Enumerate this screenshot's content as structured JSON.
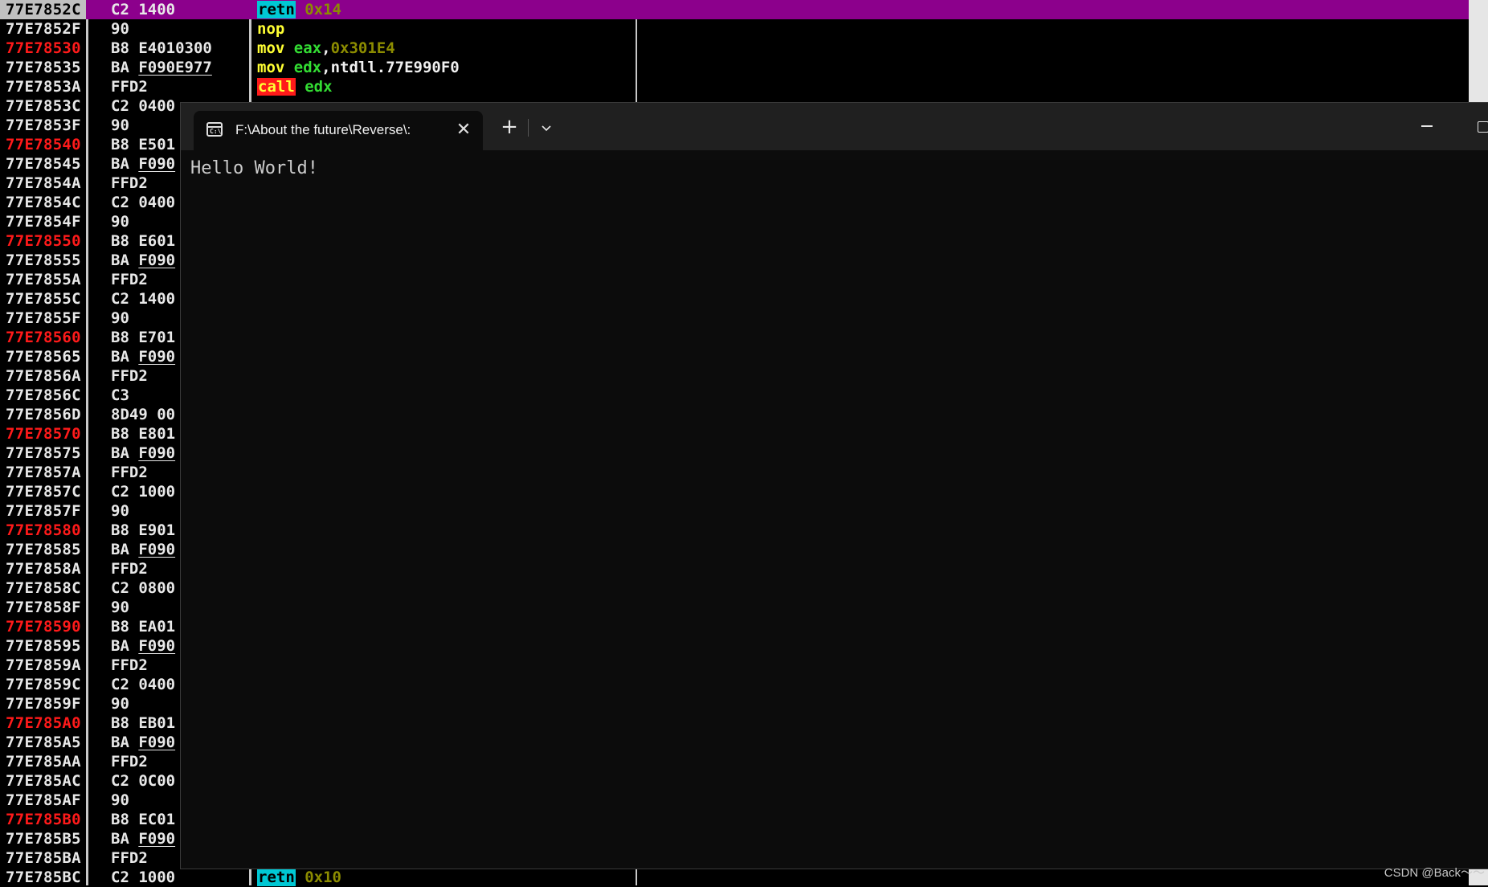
{
  "disassembly": {
    "top_rows": [
      {
        "addr": "77E7852C",
        "hex": "C2 1400",
        "mnemonic": "retn",
        "operand": "0x14",
        "selected": true
      },
      {
        "addr": "77E7852F",
        "hex": "90",
        "mnemonic": "nop",
        "operand": ""
      },
      {
        "addr": "77E78530",
        "hex": "B8 E4010300",
        "mnemonic": "mov",
        "operand_reg": "eax",
        "operand": "0x301E4",
        "red": true
      },
      {
        "addr": "77E78535",
        "hex_prefix": "BA ",
        "hex_u": "F090E977",
        "mnemonic": "mov",
        "operand_reg": "edx",
        "operand": "ntdll.77E990F0"
      },
      {
        "addr": "77E7853A",
        "hex": "FFD2",
        "mnemonic": "call",
        "operand_reg": "edx",
        "operand": ""
      }
    ],
    "rows": [
      {
        "addr": "77E7853C",
        "hex": "C2 0400"
      },
      {
        "addr": "77E7853F",
        "hex": "90"
      },
      {
        "addr": "77E78540",
        "hex": "B8 E501",
        "red": true
      },
      {
        "addr": "77E78545",
        "hex_prefix": "BA ",
        "hex_u": "F090"
      },
      {
        "addr": "77E7854A",
        "hex": "FFD2"
      },
      {
        "addr": "77E7854C",
        "hex": "C2 0400"
      },
      {
        "addr": "77E7854F",
        "hex": "90"
      },
      {
        "addr": "77E78550",
        "hex": "B8 E601",
        "red": true
      },
      {
        "addr": "77E78555",
        "hex_prefix": "BA ",
        "hex_u": "F090"
      },
      {
        "addr": "77E7855A",
        "hex": "FFD2"
      },
      {
        "addr": "77E7855C",
        "hex": "C2 1400"
      },
      {
        "addr": "77E7855F",
        "hex": "90"
      },
      {
        "addr": "77E78560",
        "hex": "B8 E701",
        "red": true
      },
      {
        "addr": "77E78565",
        "hex_prefix": "BA ",
        "hex_u": "F090"
      },
      {
        "addr": "77E7856A",
        "hex": "FFD2"
      },
      {
        "addr": "77E7856C",
        "hex": "C3"
      },
      {
        "addr": "77E7856D",
        "hex": "8D49 00"
      },
      {
        "addr": "77E78570",
        "hex": "B8 E801",
        "red": true
      },
      {
        "addr": "77E78575",
        "hex_prefix": "BA ",
        "hex_u": "F090"
      },
      {
        "addr": "77E7857A",
        "hex": "FFD2"
      },
      {
        "addr": "77E7857C",
        "hex": "C2 1000"
      },
      {
        "addr": "77E7857F",
        "hex": "90"
      },
      {
        "addr": "77E78580",
        "hex": "B8 E901",
        "red": true
      },
      {
        "addr": "77E78585",
        "hex_prefix": "BA ",
        "hex_u": "F090"
      },
      {
        "addr": "77E7858A",
        "hex": "FFD2"
      },
      {
        "addr": "77E7858C",
        "hex": "C2 0800"
      },
      {
        "addr": "77E7858F",
        "hex": "90"
      },
      {
        "addr": "77E78590",
        "hex": "B8 EA01",
        "red": true
      },
      {
        "addr": "77E78595",
        "hex_prefix": "BA ",
        "hex_u": "F090"
      },
      {
        "addr": "77E7859A",
        "hex": "FFD2"
      },
      {
        "addr": "77E7859C",
        "hex": "C2 0400"
      },
      {
        "addr": "77E7859F",
        "hex": "90"
      },
      {
        "addr": "77E785A0",
        "hex": "B8 EB01",
        "red": true
      },
      {
        "addr": "77E785A5",
        "hex_prefix": "BA ",
        "hex_u": "F090"
      },
      {
        "addr": "77E785AA",
        "hex": "FFD2"
      },
      {
        "addr": "77E785AC",
        "hex": "C2 0C00"
      },
      {
        "addr": "77E785AF",
        "hex": "90"
      },
      {
        "addr": "77E785B0",
        "hex": "B8 EC01",
        "red": true
      },
      {
        "addr": "77E785B5",
        "hex_prefix": "BA ",
        "hex_u": "F090"
      },
      {
        "addr": "77E785BA",
        "hex": "FFD2"
      },
      {
        "addr": "77E785BC",
        "hex": "C2 1000",
        "mnemonic": "retn",
        "operand": "0x10"
      }
    ]
  },
  "terminal": {
    "tab_title": "F:\\About the future\\Reverse\\:",
    "icon_label": "C:\\",
    "output": "Hello World!"
  },
  "watermark": "CSDN @Back～～",
  "colors": {
    "selected_row": "#8c008c",
    "mnemonic_highlight": "#00c8d4",
    "call_highlight": "#ff1a1a",
    "entry_address": "#ff1a1a",
    "terminal_bg": "#0c0c0c"
  },
  "icons": {
    "tab_icon": "terminal-window-icon",
    "close": "close-icon",
    "new_tab": "plus-icon",
    "dropdown": "chevron-down-icon",
    "minimize": "minimize-icon",
    "maximize": "maximize-icon"
  }
}
